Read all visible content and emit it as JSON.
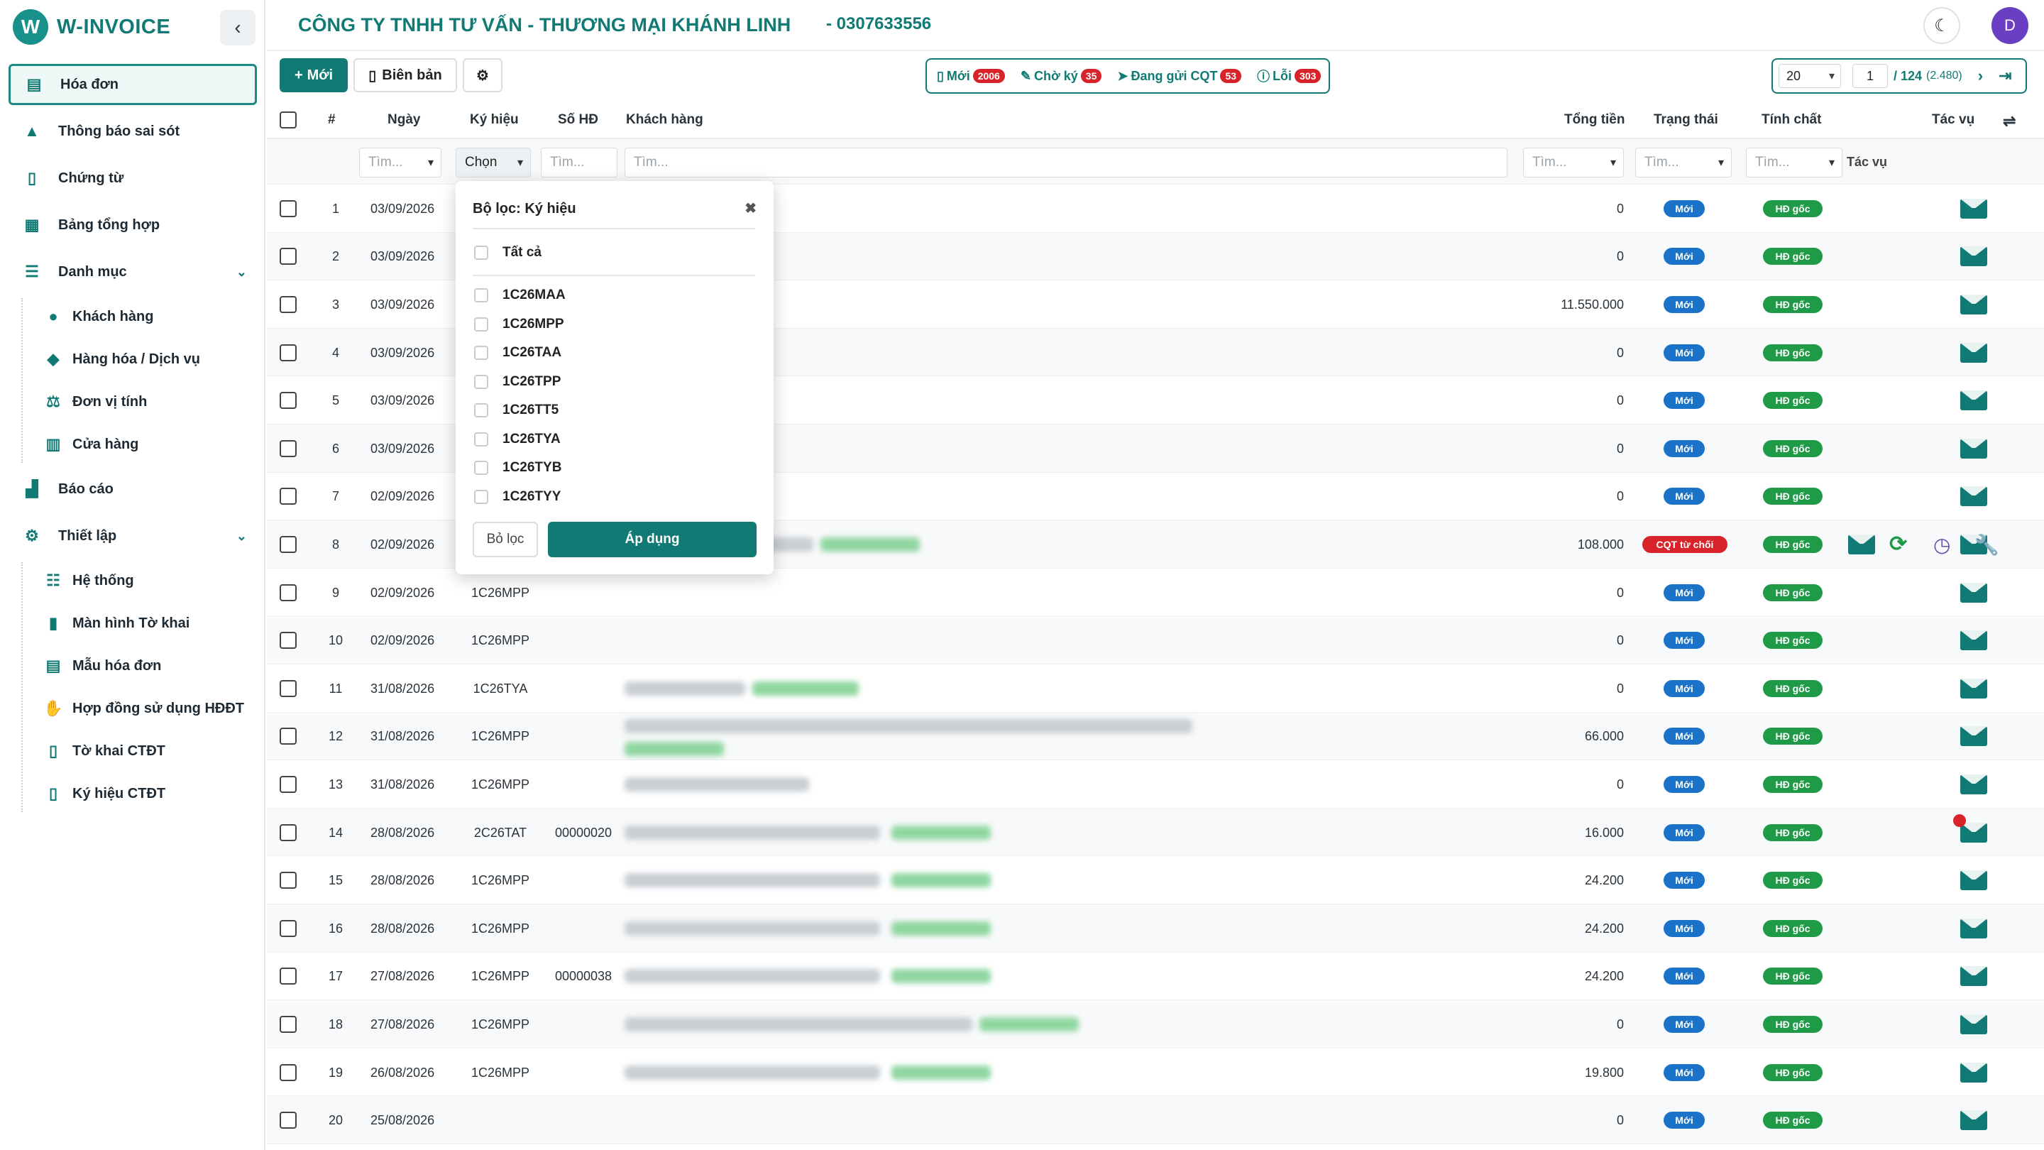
{
  "brand": {
    "name": "W-INVOICE",
    "logo_letter": "W"
  },
  "sidebar": {
    "items": [
      {
        "label": "Hóa đơn",
        "icon": "invoice-icon",
        "active": true
      },
      {
        "label": "Thông báo sai sót",
        "icon": "warning-icon"
      },
      {
        "label": "Chứng từ",
        "icon": "document-icon"
      },
      {
        "label": "Bảng tổng hợp",
        "icon": "table-icon"
      },
      {
        "label": "Danh mục",
        "icon": "list-icon",
        "expanded": true
      },
      {
        "label": "Báo cáo",
        "icon": "chart-icon"
      },
      {
        "label": "Thiết lập",
        "icon": "cogs-icon",
        "expanded": true
      }
    ],
    "danh_muc": [
      {
        "label": "Khách hàng",
        "icon": "users-icon"
      },
      {
        "label": "Hàng hóa / Dịch vụ",
        "icon": "cubes-icon"
      },
      {
        "label": "Đơn vị tính",
        "icon": "scale-icon"
      },
      {
        "label": "Cửa hàng",
        "icon": "store-icon"
      }
    ],
    "thiet_lap": [
      {
        "label": "Hệ thống",
        "icon": "sliders-icon"
      },
      {
        "label": "Màn hình Tờ khai",
        "icon": "file-icon"
      },
      {
        "label": "Mẫu hóa đơn",
        "icon": "file-alt-icon"
      },
      {
        "label": "Hợp đồng sử dụng HĐĐT",
        "icon": "handshake-icon"
      },
      {
        "label": "Tờ khai CTĐT",
        "icon": "file-icon"
      },
      {
        "label": "Ký hiệu CTĐT",
        "icon": "file-search-icon"
      }
    ]
  },
  "header": {
    "company": "CÔNG TY TNHH TƯ VẤN - THƯƠNG MẠI KHÁNH LINH",
    "tax_code": "- 0307633556",
    "avatar": "D",
    "theme_icon": "moon-icon"
  },
  "toolbar": {
    "new_label": "Mới",
    "report_label": "Biên bản",
    "settings_icon": "gear-icon",
    "status": [
      {
        "label": "Mới",
        "count": "2006",
        "icon": "file-icon"
      },
      {
        "label": "Chờ ký",
        "count": "35",
        "icon": "edit-icon"
      },
      {
        "label": "Đang gửi CQT",
        "count": "53",
        "icon": "send-icon"
      },
      {
        "label": "Lỗi",
        "count": "303",
        "icon": "info-icon"
      }
    ],
    "pager": {
      "page_size": "20",
      "page": "1",
      "total_pages": "/ 124",
      "records": "(2.480)"
    }
  },
  "table": {
    "headers": {
      "num": "#",
      "date": "Ngày",
      "symbol": "Ký hiệu",
      "invoice_no": "Số HĐ",
      "customer": "Khách hàng",
      "total": "Tổng tiền",
      "status": "Trạng thái",
      "nature": "Tính chất",
      "actions": "Tác vụ"
    },
    "filters": {
      "search": "Tìm...",
      "choose": "Chọn",
      "actions": "Tác vụ"
    },
    "rows": [
      {
        "n": "1",
        "date": "03/09/2026",
        "symbol": "",
        "no": "",
        "total": "0",
        "status": "Mới",
        "nature": "HĐ gốc"
      },
      {
        "n": "2",
        "date": "03/09/2026",
        "symbol": "",
        "no": "",
        "total": "0",
        "status": "Mới",
        "nature": "HĐ gốc"
      },
      {
        "n": "3",
        "date": "03/09/2026",
        "symbol": "",
        "no": "",
        "total": "11.550.000",
        "status": "Mới",
        "nature": "HĐ gốc"
      },
      {
        "n": "4",
        "date": "03/09/2026",
        "symbol": "",
        "no": "",
        "total": "0",
        "status": "Mới",
        "nature": "HĐ gốc"
      },
      {
        "n": "5",
        "date": "03/09/2026",
        "symbol": "",
        "no": "",
        "total": "0",
        "status": "Mới",
        "nature": "HĐ gốc"
      },
      {
        "n": "6",
        "date": "03/09/2026",
        "symbol": "",
        "no": "",
        "total": "0",
        "status": "Mới",
        "nature": "HĐ gốc"
      },
      {
        "n": "7",
        "date": "02/09/2026",
        "symbol": "",
        "no": "",
        "total": "0",
        "status": "Mới",
        "nature": "HĐ gốc"
      },
      {
        "n": "8",
        "date": "02/09/2026",
        "symbol": "",
        "no": "",
        "total": "108.000",
        "status": "CQT từ chối",
        "nature": "HĐ gốc"
      },
      {
        "n": "9",
        "date": "02/09/2026",
        "symbol": "1C26MPP",
        "no": "",
        "total": "0",
        "status": "Mới",
        "nature": "HĐ gốc"
      },
      {
        "n": "10",
        "date": "02/09/2026",
        "symbol": "1C26MPP",
        "no": "",
        "total": "0",
        "status": "Mới",
        "nature": "HĐ gốc"
      },
      {
        "n": "11",
        "date": "31/08/2026",
        "symbol": "1C26TYA",
        "no": "",
        "total": "0",
        "status": "Mới",
        "nature": "HĐ gốc"
      },
      {
        "n": "12",
        "date": "31/08/2026",
        "symbol": "1C26MPP",
        "no": "",
        "total": "66.000",
        "status": "Mới",
        "nature": "HĐ gốc"
      },
      {
        "n": "13",
        "date": "31/08/2026",
        "symbol": "1C26MPP",
        "no": "",
        "total": "0",
        "status": "Mới",
        "nature": "HĐ gốc"
      },
      {
        "n": "14",
        "date": "28/08/2026",
        "symbol": "2C26TAT",
        "no": "00000020",
        "total": "16.000",
        "status": "Mới",
        "nature": "HĐ gốc"
      },
      {
        "n": "15",
        "date": "28/08/2026",
        "symbol": "1C26MPP",
        "no": "",
        "total": "24.200",
        "status": "Mới",
        "nature": "HĐ gốc"
      },
      {
        "n": "16",
        "date": "28/08/2026",
        "symbol": "1C26MPP",
        "no": "",
        "total": "24.200",
        "status": "Mới",
        "nature": "HĐ gốc"
      },
      {
        "n": "17",
        "date": "27/08/2026",
        "symbol": "1C26MPP",
        "no": "00000038",
        "total": "24.200",
        "status": "Mới",
        "nature": "HĐ gốc"
      },
      {
        "n": "18",
        "date": "27/08/2026",
        "symbol": "1C26MPP",
        "no": "",
        "total": "0",
        "status": "Mới",
        "nature": "HĐ gốc"
      },
      {
        "n": "19",
        "date": "26/08/2026",
        "symbol": "1C26MPP",
        "no": "",
        "total": "19.800",
        "status": "Mới",
        "nature": "HĐ gốc"
      },
      {
        "n": "20",
        "date": "25/08/2026",
        "symbol": "",
        "no": "",
        "total": "0",
        "status": "Mới",
        "nature": "HĐ gốc"
      }
    ]
  },
  "popup": {
    "title": "Bộ lọc: Ký hiệu",
    "all_label": "Tất cả",
    "options": [
      "1C26MAA",
      "1C26MPP",
      "1C26TAA",
      "1C26TPP",
      "1C26TT5",
      "1C26TYA",
      "1C26TYB",
      "1C26TYY"
    ],
    "clear_label": "Bỏ lọc",
    "apply_label": "Áp dụng"
  },
  "colors": {
    "brand": "#117a74",
    "status_new": "#1a73c8",
    "status_original": "#1f9a47",
    "status_rejected": "#d8232a"
  }
}
